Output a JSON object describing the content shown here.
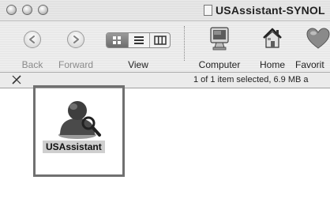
{
  "window": {
    "title": "USAssistant-SYNOL",
    "traffic_lights": [
      "close",
      "minimize",
      "zoom"
    ]
  },
  "toolbar": {
    "back_label": "Back",
    "forward_label": "Forward",
    "view_label": "View",
    "view_modes": [
      "icon",
      "list",
      "column"
    ],
    "view_selected": "icon",
    "computer_label": "Computer",
    "home_label": "Home",
    "favorites_label": "Favorit"
  },
  "status": {
    "text": "1 of 1 item selected, 6.9 MB a"
  },
  "items": [
    {
      "label": "USAssistant",
      "icon": "installer-person-icon",
      "selected": true
    }
  ]
}
